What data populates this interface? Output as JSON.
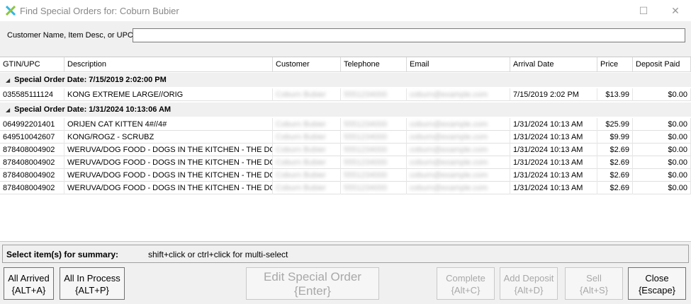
{
  "window": {
    "title": "Find Special Orders for: Coburn Bubier"
  },
  "search": {
    "label": "Customer Name, Item Desc, or UPC:",
    "value": ""
  },
  "columns": [
    "GTIN/UPC",
    "Description",
    "Customer",
    "Telephone",
    "Email",
    "Arrival Date",
    "Price",
    "Deposit Paid"
  ],
  "groups": [
    {
      "label": "Special Order Date: 7/15/2019 2:02:00 PM",
      "rows": [
        {
          "upc": "035585111124",
          "desc": "KONG EXTREME LARGE//ORIG",
          "customer": "Coburn Bubier",
          "phone": "5551234000",
          "email": "coburn@example.com",
          "arrival": "7/15/2019 2:02 PM",
          "price": "$13.99",
          "deposit": "$0.00"
        }
      ]
    },
    {
      "label": "Special Order Date: 1/31/2024 10:13:06 AM",
      "rows": [
        {
          "upc": "064992201401",
          "desc": "ORIJEN CAT KITTEN 4#//4#",
          "customer": "Coburn Bubier",
          "phone": "5551234000",
          "email": "coburn@example.com",
          "arrival": "1/31/2024 10:13 AM",
          "price": "$25.99",
          "deposit": "$0.00"
        },
        {
          "upc": "649510042607",
          "desc": "KONG/ROGZ - SCRUBZ",
          "customer": "Coburn Bubier",
          "phone": "5551234000",
          "email": "coburn@example.com",
          "arrival": "1/31/2024 10:13 AM",
          "price": "$9.99",
          "deposit": "$0.00"
        },
        {
          "upc": "878408004902",
          "desc": "WERUVA/DOG FOOD - DOGS IN THE KITCHEN - THE DO...",
          "customer": "Coburn Bubier",
          "phone": "5551234000",
          "email": "coburn@example.com",
          "arrival": "1/31/2024 10:13 AM",
          "price": "$2.69",
          "deposit": "$0.00"
        },
        {
          "upc": "878408004902",
          "desc": "WERUVA/DOG FOOD - DOGS IN THE KITCHEN - THE DO...",
          "customer": "Coburn Bubier",
          "phone": "5551234000",
          "email": "coburn@example.com",
          "arrival": "1/31/2024 10:13 AM",
          "price": "$2.69",
          "deposit": "$0.00"
        },
        {
          "upc": "878408004902",
          "desc": "WERUVA/DOG FOOD - DOGS IN THE KITCHEN - THE DO...",
          "customer": "Coburn Bubier",
          "phone": "5551234000",
          "email": "coburn@example.com",
          "arrival": "1/31/2024 10:13 AM",
          "price": "$2.69",
          "deposit": "$0.00"
        },
        {
          "upc": "878408004902",
          "desc": "WERUVA/DOG FOOD - DOGS IN THE KITCHEN - THE DO...",
          "customer": "Coburn Bubier",
          "phone": "5551234000",
          "email": "coburn@example.com",
          "arrival": "1/31/2024 10:13 AM",
          "price": "$2.69",
          "deposit": "$0.00"
        }
      ]
    }
  ],
  "summary": {
    "label": "Select item(s) for summary:",
    "hint": "shift+click or ctrl+click for multi-select"
  },
  "buttons": {
    "all_arrived": "All Arrived\n{ALT+A}",
    "all_in_process": "All In Process\n{ALT+P}",
    "edit_special_order": "Edit Special Order\n{Enter}",
    "complete": "Complete\n{Alt+C}",
    "add_deposit": "Add Deposit\n{Alt+D}",
    "sell": "Sell\n{Alt+S}",
    "close": "Close\n{Escape}"
  },
  "icons": {
    "app": "x-logo-icon",
    "maximize": "maximize-icon",
    "close": "close-icon",
    "group_toggle": "expand-triangle-icon"
  },
  "colors": {
    "logo_a": "#2fb8e6",
    "logo_b": "#8cc63f",
    "disabled_text": "#a8a8a8"
  }
}
